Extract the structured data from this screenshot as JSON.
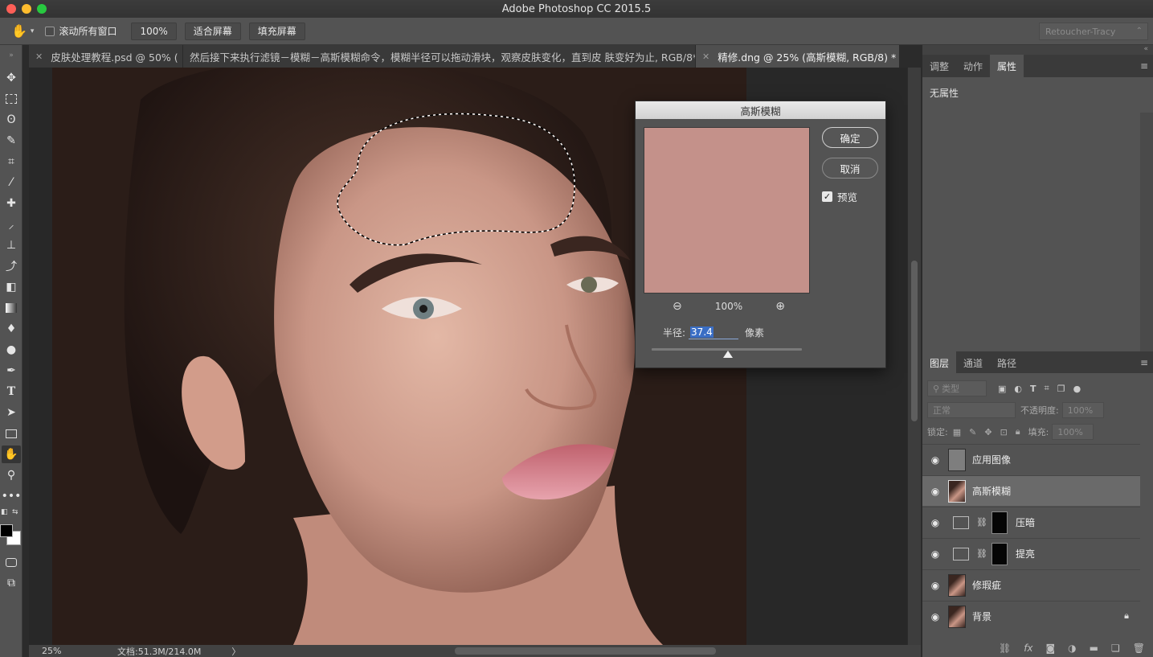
{
  "app": {
    "title": "Adobe Photoshop CC 2015.5"
  },
  "options_bar": {
    "scroll_all_windows": "滚动所有窗口",
    "zoom_100": "100%",
    "fit_screen": "适合屏幕",
    "fill_screen": "填充屏幕",
    "workspace": "Retoucher-Tracy"
  },
  "tabs": [
    {
      "label": "皮肤处理教程.psd @ 50% (",
      "active": false
    },
    {
      "label": "然后接下来执行滤镜－模糊－高斯模糊命令，模糊半径可以拖动滑块，观察皮肤变化，直到皮 肤变好为止, RGB/8*) *",
      "active": false
    },
    {
      "label": "精修.dng @ 25% (高斯模糊, RGB/8) *",
      "active": true
    }
  ],
  "dialog": {
    "title": "高斯模糊",
    "ok": "确定",
    "cancel": "取消",
    "preview_label": "预览",
    "preview_checked": true,
    "zoom": "100%",
    "radius_label": "半径:",
    "radius_value": "37.4",
    "radius_unit": "像素",
    "preview_color": "#c4918a"
  },
  "right_panel": {
    "top_tabs": [
      "调整",
      "动作",
      "属性"
    ],
    "top_active": "属性",
    "properties_text": "无属性",
    "layers_tabs": [
      "图层",
      "通道",
      "路径"
    ],
    "layers_active": "图层",
    "filter_kind": "类型",
    "blend_mode": "正常",
    "opacity_label": "不透明度:",
    "opacity_value": "100%",
    "lock_label": "锁定:",
    "fill_label": "填充:",
    "fill_value": "100%",
    "layers": [
      {
        "name": "应用图像",
        "thumb": "gray",
        "selected": false,
        "adjustment": false,
        "locked": false
      },
      {
        "name": "高斯模糊",
        "thumb": "photo",
        "selected": true,
        "adjustment": false,
        "locked": false
      },
      {
        "name": "压暗",
        "thumb": "curves",
        "selected": false,
        "adjustment": true,
        "locked": false
      },
      {
        "name": "提亮",
        "thumb": "curves",
        "selected": false,
        "adjustment": true,
        "locked": false
      },
      {
        "name": "修瑕疵",
        "thumb": "photo",
        "selected": false,
        "adjustment": false,
        "locked": false
      },
      {
        "name": "背景",
        "thumb": "photo",
        "selected": false,
        "adjustment": false,
        "locked": true
      }
    ]
  },
  "status": {
    "zoom": "25%",
    "doc_info": "文档:51.3M/214.0M",
    "arrow": "〉"
  }
}
